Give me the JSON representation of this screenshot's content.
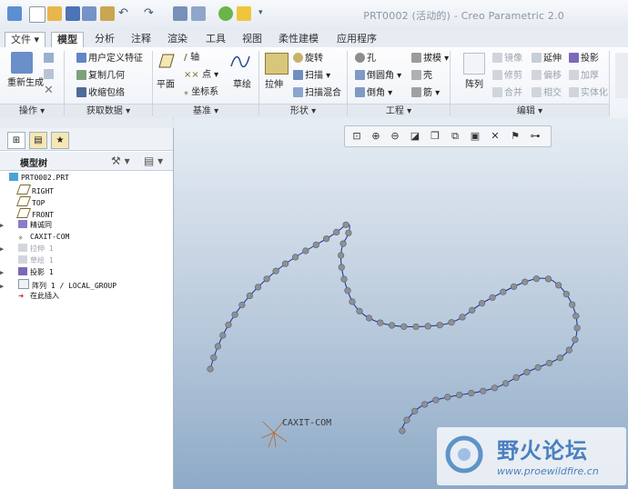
{
  "window": {
    "title": "PRT0002 (活动的) - Creo Parametric 2.0"
  },
  "tabs": [
    {
      "label": "文件"
    },
    {
      "label": "模型"
    },
    {
      "label": "分析"
    },
    {
      "label": "注释"
    },
    {
      "label": "渲染"
    },
    {
      "label": "工具"
    },
    {
      "label": "视图"
    },
    {
      "label": "柔性建模"
    },
    {
      "label": "应用程序"
    }
  ],
  "active_tab": "模型",
  "ribbon": {
    "ops": {
      "regen": "重新生成",
      "footer": "操作"
    },
    "getdata": {
      "udf": "用户定义特征",
      "copygeom": "复制几何",
      "shrinkwrap": "收缩包络",
      "footer": "获取数据"
    },
    "datum": {
      "plane": "平面",
      "axis": "轴",
      "point": "点",
      "csys": "坐标系",
      "sketch": "草绘",
      "footer": "基准"
    },
    "shapes": {
      "extrude": "拉伸",
      "revolve": "旋转",
      "sweep": "扫描",
      "blend": "扫描混合",
      "footer": "形状"
    },
    "eng": {
      "hole": "孔",
      "draft": "拔模",
      "round": "倒圆角",
      "shell": "壳",
      "chamfer": "倒角",
      "rib": "筋",
      "footer": "工程"
    },
    "edit": {
      "pattern": "阵列",
      "mirror": "镜像",
      "extend": "延伸",
      "project": "投影",
      "trim": "修剪",
      "offset": "偏移",
      "thicken": "加厚",
      "merge": "合并",
      "intersect": "相交",
      "solidify": "实体化",
      "footer": "编辑"
    }
  },
  "model_tree": {
    "title": "模型树",
    "nodes": [
      {
        "label": "PRT0002.PRT"
      },
      {
        "label": "RIGHT"
      },
      {
        "label": "TOP"
      },
      {
        "label": "FRONT"
      },
      {
        "label": "精诚同"
      },
      {
        "label": "CAXIT-COM"
      },
      {
        "label": "拉伸 1"
      },
      {
        "label": "草绘 1"
      },
      {
        "label": "投影 1"
      },
      {
        "label": "阵列 1 / LOCAL_GROUP"
      },
      {
        "label": "在此插入"
      }
    ]
  },
  "viewport": {
    "csys_label": "CAXIT-COM"
  },
  "watermark": {
    "name": "野火论坛",
    "url": "www.proewildfire.cn"
  },
  "colors": {
    "accent": "#3a67b5",
    "curve": "#1a2b9b",
    "bead": "#8c9098"
  }
}
